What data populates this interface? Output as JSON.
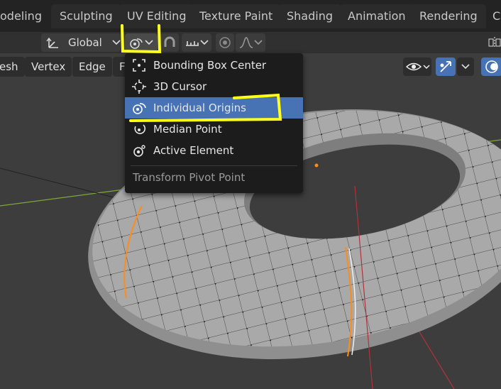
{
  "workspace_tabs": [
    "odeling",
    "Sculpting",
    "UV Editing",
    "Texture Paint",
    "Shading",
    "Animation",
    "Rendering",
    "Co"
  ],
  "header": {
    "orientation_label": "Global"
  },
  "edit_menus": [
    "esh",
    "Vertex",
    "Edge",
    "F"
  ],
  "pivot_menu": {
    "title": "Transform Pivot Point",
    "selected_index": 2,
    "items": [
      {
        "label": "Bounding Box Center",
        "icon": "bounding-box-center-icon"
      },
      {
        "label": "3D Cursor",
        "icon": "3d-cursor-icon"
      },
      {
        "label": "Individual Origins",
        "icon": "individual-origins-icon"
      },
      {
        "label": "Median Point",
        "icon": "median-point-icon"
      },
      {
        "label": "Active Element",
        "icon": "active-element-icon"
      }
    ]
  },
  "colors": {
    "selected_item": "#4772b3",
    "annotation_highlight": "#ffff1a",
    "selected_edge": "#ff8c1a",
    "x_axis": "#b4313b",
    "y_axis": "#7ea73a"
  }
}
